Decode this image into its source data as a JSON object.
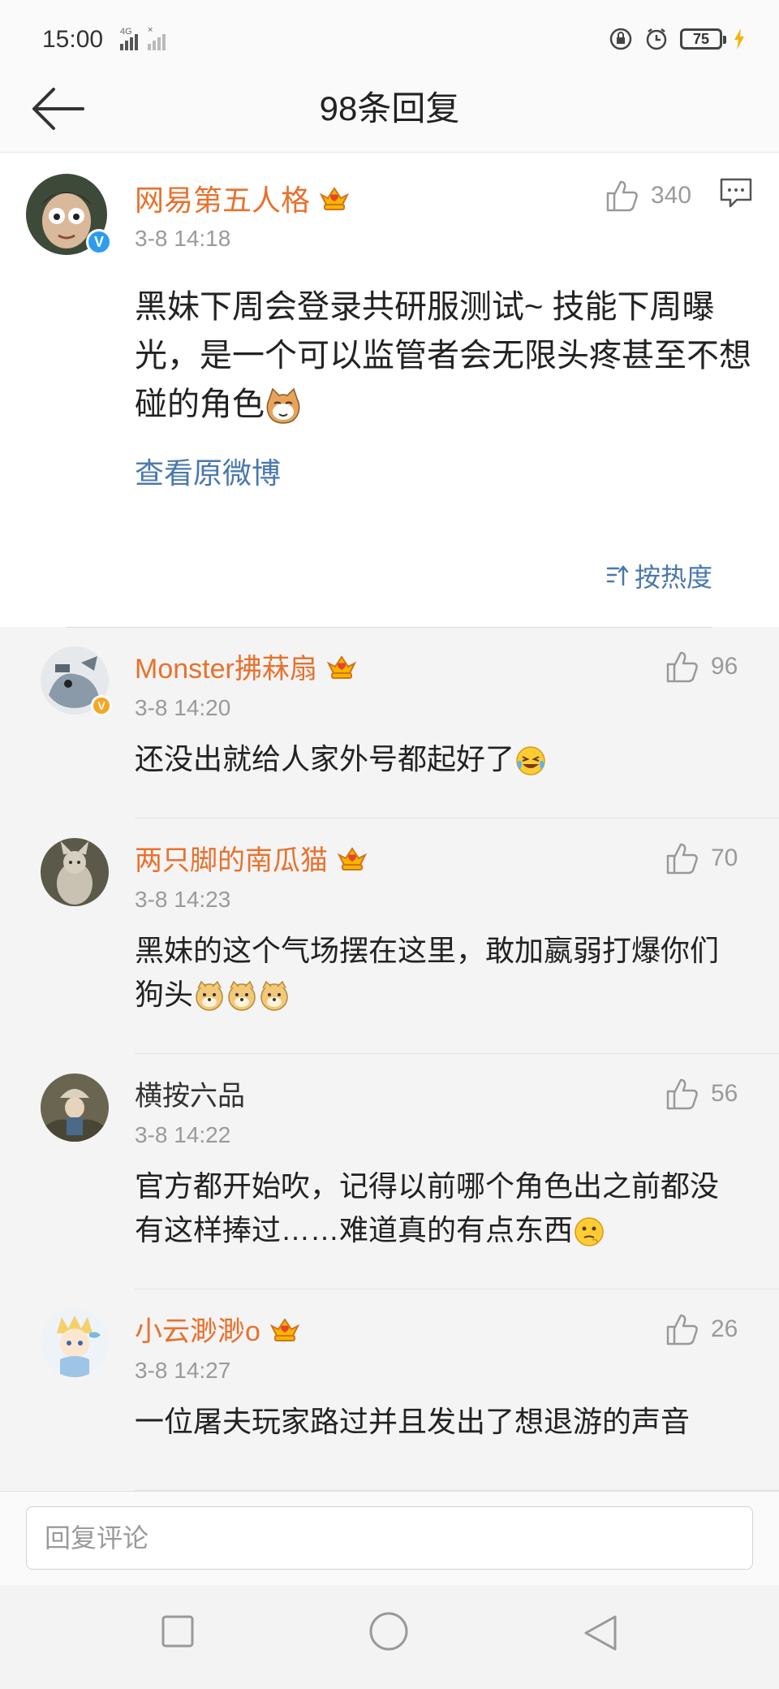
{
  "status_bar": {
    "time": "15:00",
    "network": "4G",
    "battery": "75"
  },
  "nav": {
    "title": "98条回复"
  },
  "post": {
    "author": "网易第五人格",
    "time": "3-8 14:18",
    "likes": "340",
    "text": "黑妹下周会登录共研服测试~ 技能下周曝光，是一个可以监管者会无限头疼甚至不想碰的角色",
    "view_original": "查看原微博",
    "sort_label": "按热度"
  },
  "comments": [
    {
      "username": "Monster拂菻扇",
      "time": "3-8 14:20",
      "likes": "96",
      "text": "还没出就给人家外号都起好了"
    },
    {
      "username": "两只脚的南瓜猫",
      "time": "3-8 14:23",
      "likes": "70",
      "text": "黑妹的这个气场摆在这里，敢加嬴弱打爆你们狗头"
    },
    {
      "username": "横按六品",
      "time": "3-8 14:22",
      "likes": "56",
      "text": "官方都开始吹，记得以前哪个角色出之前都没有这样捧过……难道真的有点东西"
    },
    {
      "username": "小云渺渺o",
      "time": "3-8 14:27",
      "likes": "26",
      "text": "一位屠夫玩家路过并且发出了想退游的声音"
    }
  ],
  "reply": {
    "placeholder": "回复评论"
  },
  "colors": {
    "username": "#e8712d",
    "link": "#4a78ad",
    "meta": "#9a9a9a"
  },
  "icons": [
    "back-arrow-icon",
    "thumb-up-icon",
    "comment-icon",
    "vip-crown-icon",
    "verified-icon",
    "sort-icon",
    "square-icon",
    "circle-icon",
    "triangle-back-icon"
  ]
}
